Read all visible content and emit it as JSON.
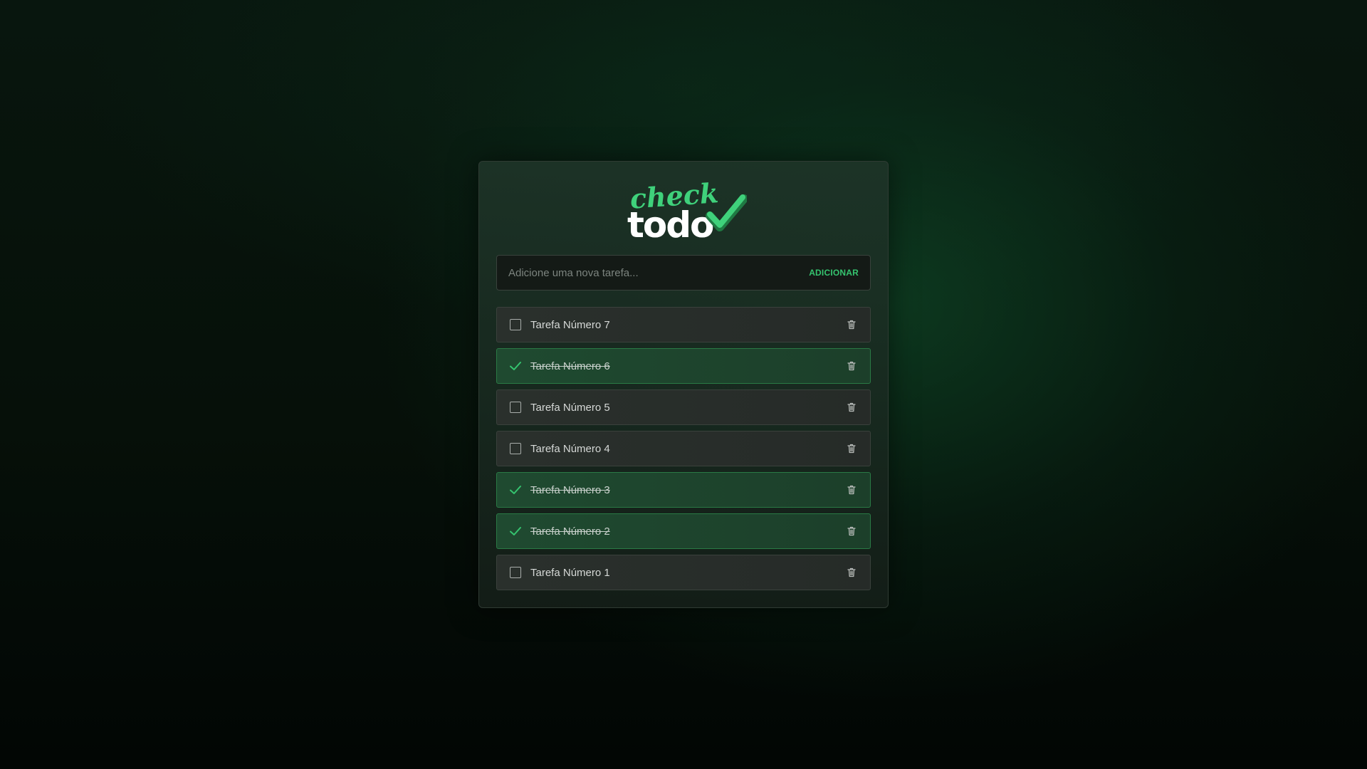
{
  "app": {
    "logo": {
      "top_word": "check",
      "bottom_word": "todo"
    }
  },
  "new_task": {
    "placeholder": "Adicione uma nova tarefa...",
    "value": "",
    "add_label": "ADICIONAR"
  },
  "tasks": [
    {
      "label": "Tarefa Número 7",
      "completed": false
    },
    {
      "label": "Tarefa Número 6",
      "completed": true
    },
    {
      "label": "Tarefa Número 5",
      "completed": false
    },
    {
      "label": "Tarefa Número 4",
      "completed": false
    },
    {
      "label": "Tarefa Número 3",
      "completed": true
    },
    {
      "label": "Tarefa Número 2",
      "completed": true
    },
    {
      "label": "Tarefa Número 1",
      "completed": false
    }
  ],
  "icons": {
    "checkbox": "checkbox-empty-icon",
    "done": "check-icon",
    "delete": "trash-icon"
  },
  "colors": {
    "accent": "#35c46f",
    "logo_top": "#3fd17b",
    "logo_bottom": "#ffffff"
  }
}
